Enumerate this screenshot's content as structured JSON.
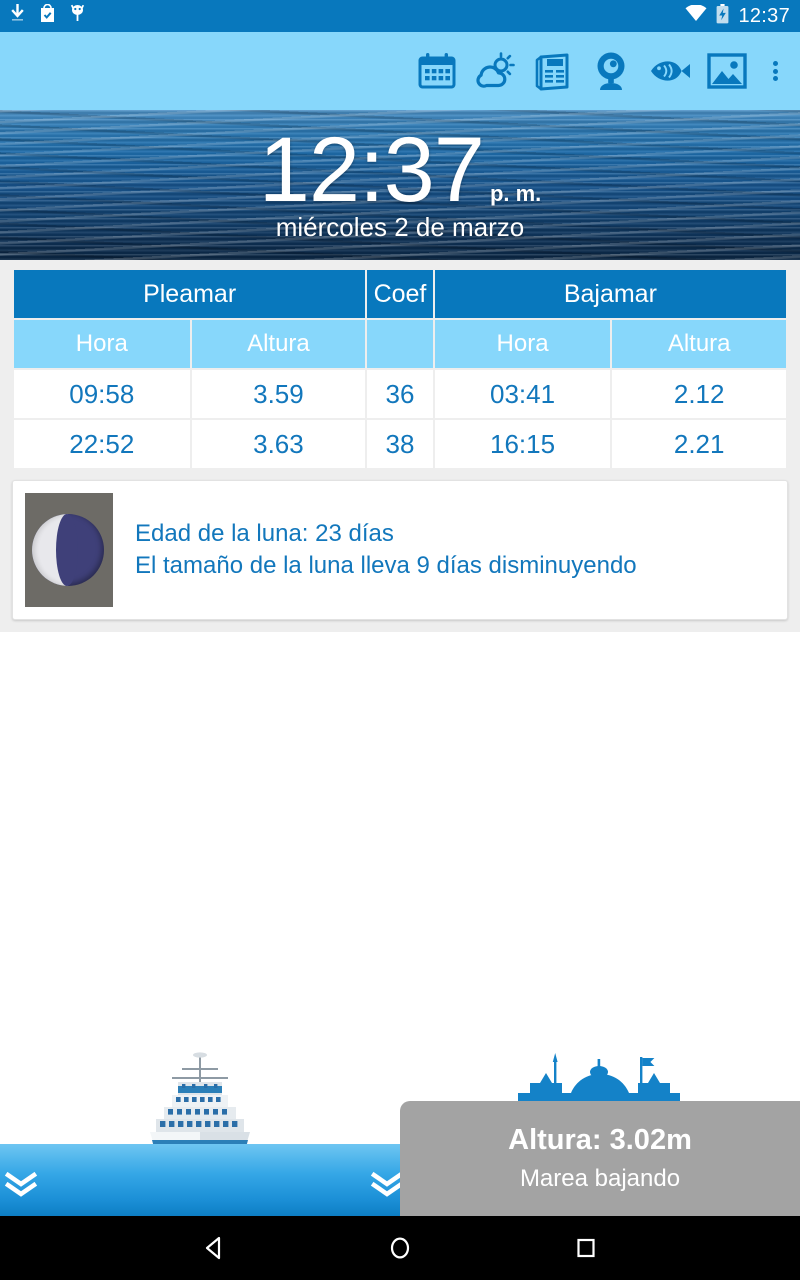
{
  "status_bar": {
    "time": "12:37",
    "left_icons": [
      {
        "name": "download-icon"
      },
      {
        "name": "play-store-check-icon"
      },
      {
        "name": "usb-debug-icon"
      }
    ],
    "right_icons": [
      {
        "name": "wifi-icon"
      },
      {
        "name": "battery-charging-icon"
      }
    ]
  },
  "toolbar": {
    "background": "#87d7fb",
    "accent": "#0878bd",
    "items": [
      {
        "name": "calendar-icon",
        "label": "Calendario"
      },
      {
        "name": "weather-icon",
        "label": "Tiempo"
      },
      {
        "name": "news-icon",
        "label": "Noticias"
      },
      {
        "name": "webcam-icon",
        "label": "Webcam"
      },
      {
        "name": "fish-icon",
        "label": "Pesca"
      },
      {
        "name": "photo-gallery-icon",
        "label": "Fotos"
      },
      {
        "name": "overflow-menu-icon",
        "label": "Más opciones"
      }
    ]
  },
  "hero": {
    "time": "12:37",
    "ampm": "p. m.",
    "date": "miércoles 2 de marzo"
  },
  "tide_table": {
    "group_headers": {
      "high_tide": "Pleamar",
      "coef": "Coef",
      "low_tide": "Bajamar"
    },
    "sub_headers": {
      "hora": "Hora",
      "altura": "Altura",
      "hora2": "Hora",
      "altura2": "Altura"
    },
    "rows": [
      {
        "pleamar_hora": "09:58",
        "pleamar_altura": "3.59",
        "coef": "36",
        "bajamar_hora": "03:41",
        "bajamar_altura": "2.12"
      },
      {
        "pleamar_hora": "22:52",
        "pleamar_altura": "3.63",
        "coef": "38",
        "bajamar_hora": "16:15",
        "bajamar_altura": "2.21"
      }
    ],
    "colors": {
      "header": "#0878bd",
      "subheader": "#87d7fb",
      "cell_text": "#1277bc"
    }
  },
  "moon_card": {
    "image_name": "moon-phase-waning-crescent",
    "line1": "Edad de la luna: 23 días",
    "line2": "El tamaño de la luna lleva 9 días disminuyendo"
  },
  "scene": {
    "ship_name": "cruise-ship-illustration",
    "building_name": "casino-building-silhouette",
    "chevron_name": "double-chevron-down-icon"
  },
  "toast": {
    "title": "Altura: 3.02m",
    "subtitle": "Marea bajando"
  },
  "nav_bar": {
    "back": "back-button",
    "home": "home-button",
    "recents": "recents-button"
  }
}
